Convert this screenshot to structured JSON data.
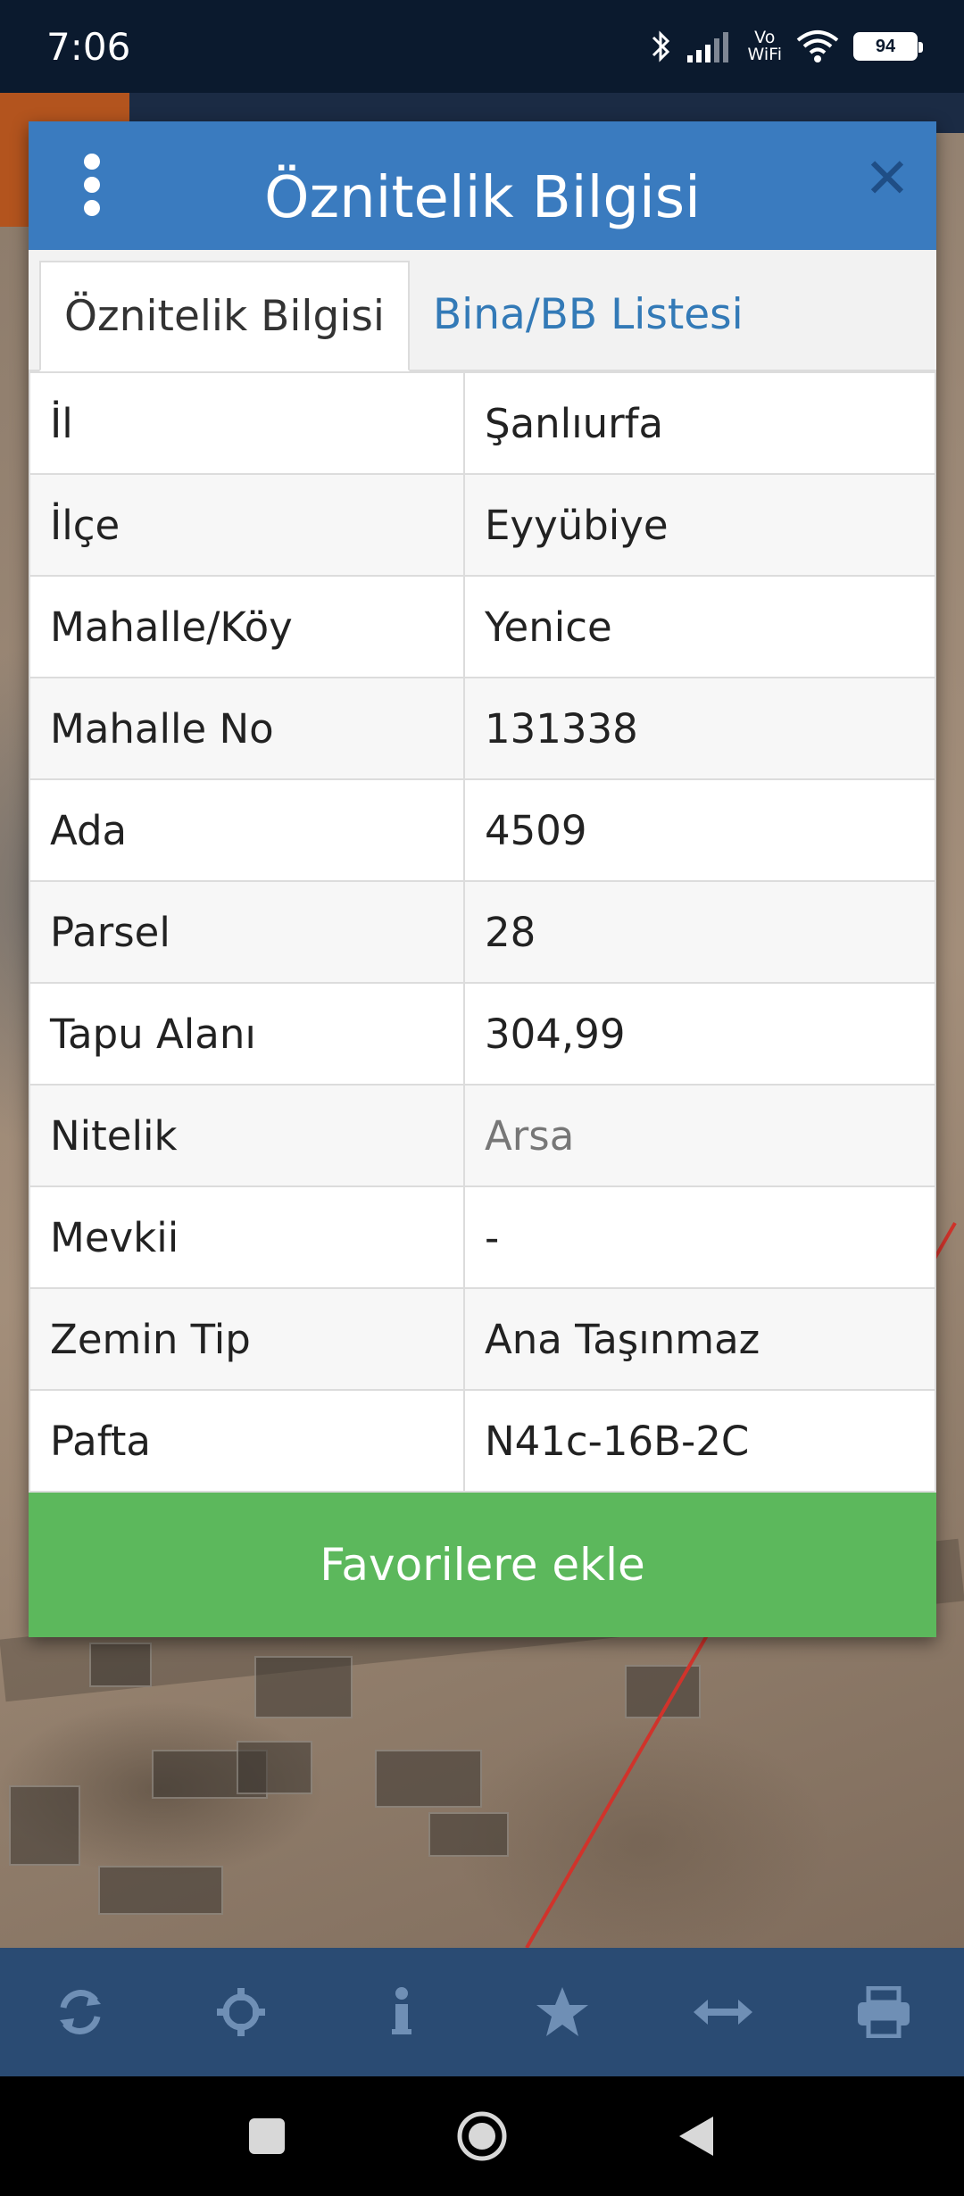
{
  "status_bar": {
    "time": "7:06",
    "vowifi": "Vo\nWiFi",
    "battery": "94"
  },
  "dialog": {
    "title": "Öznitelik Bilgisi",
    "tabs": [
      {
        "label": "Öznitelik Bilgisi",
        "active": true
      },
      {
        "label": "Bina/BB Listesi",
        "active": false
      }
    ],
    "rows": [
      {
        "key": "İl",
        "value": "Şanlıurfa"
      },
      {
        "key": "İlçe",
        "value": "Eyyübiye"
      },
      {
        "key": "Mahalle/Köy",
        "value": "Yenice"
      },
      {
        "key": "Mahalle No",
        "value": "131338"
      },
      {
        "key": "Ada",
        "value": "4509"
      },
      {
        "key": "Parsel",
        "value": "28"
      },
      {
        "key": "Tapu Alanı",
        "value": "304,99"
      },
      {
        "key": "Nitelik",
        "value": "Arsa"
      },
      {
        "key": "Mevkii",
        "value": "-"
      },
      {
        "key": "Zemin Tip",
        "value": "Ana Taşınmaz"
      },
      {
        "key": "Pafta",
        "value": "N41c-16B-2C"
      }
    ],
    "favorite_button_label": "Favorilere ekle"
  },
  "toolbar": {
    "icons": [
      "refresh-icon",
      "crosshair-icon",
      "info-icon",
      "star-icon",
      "measure-icon",
      "print-icon"
    ]
  },
  "colors": {
    "header_blue": "#3a7bbf",
    "tab_link_blue": "#337ab7",
    "button_green": "#5cb85c",
    "toolbar_blue": "#2a4b73"
  }
}
